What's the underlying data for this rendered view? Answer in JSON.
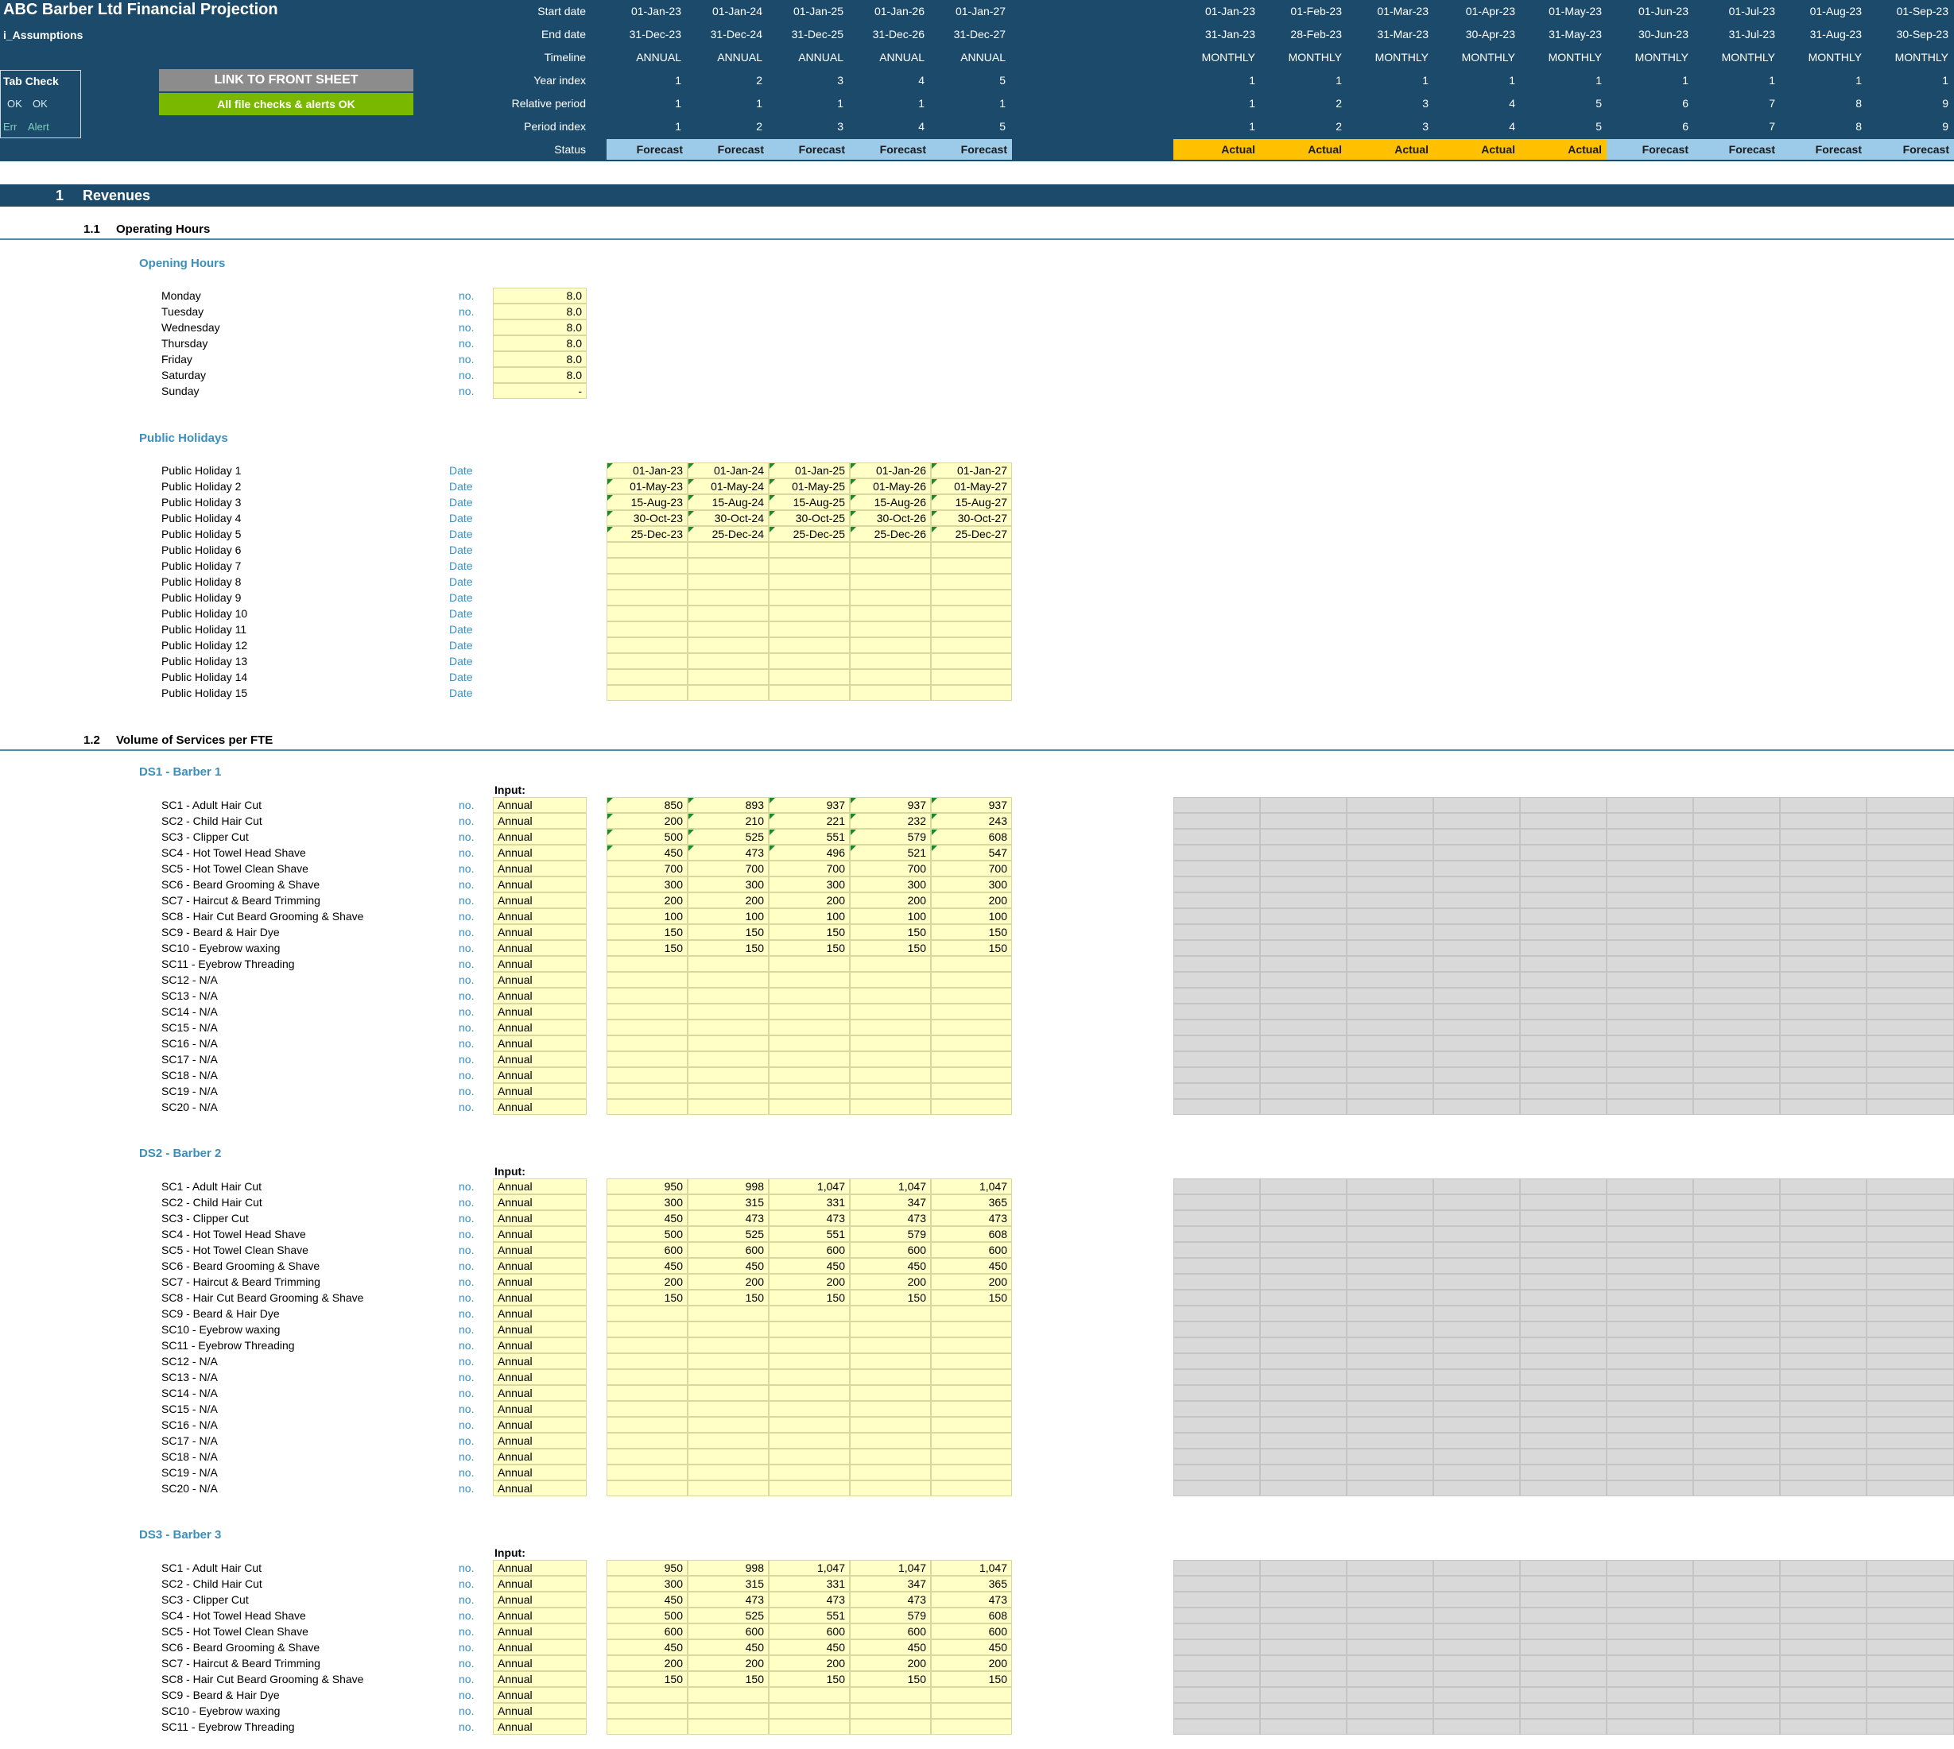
{
  "header": {
    "title": "ABC Barber Ltd Financial Projection",
    "sheet": "i_Assumptions",
    "row_labels": [
      "Start date",
      "End date",
      "Timeline",
      "Year index",
      "Relative period",
      "Period index",
      "Status"
    ],
    "annual": [
      {
        "start": "01-Jan-23",
        "end": "31-Dec-23",
        "timeline": "ANNUAL",
        "year": "1",
        "rel": "1",
        "period": "1",
        "status": "Forecast"
      },
      {
        "start": "01-Jan-24",
        "end": "31-Dec-24",
        "timeline": "ANNUAL",
        "year": "2",
        "rel": "1",
        "period": "2",
        "status": "Forecast"
      },
      {
        "start": "01-Jan-25",
        "end": "31-Dec-25",
        "timeline": "ANNUAL",
        "year": "3",
        "rel": "1",
        "period": "3",
        "status": "Forecast"
      },
      {
        "start": "01-Jan-26",
        "end": "31-Dec-26",
        "timeline": "ANNUAL",
        "year": "4",
        "rel": "1",
        "period": "4",
        "status": "Forecast"
      },
      {
        "start": "01-Jan-27",
        "end": "31-Dec-27",
        "timeline": "ANNUAL",
        "year": "5",
        "rel": "1",
        "period": "5",
        "status": "Forecast"
      }
    ],
    "monthly": [
      {
        "start": "01-Jan-23",
        "end": "31-Jan-23",
        "timeline": "MONTHLY",
        "year": "1",
        "rel": "1",
        "period": "1",
        "status": "Actual"
      },
      {
        "start": "01-Feb-23",
        "end": "28-Feb-23",
        "timeline": "MONTHLY",
        "year": "1",
        "rel": "2",
        "period": "2",
        "status": "Actual"
      },
      {
        "start": "01-Mar-23",
        "end": "31-Mar-23",
        "timeline": "MONTHLY",
        "year": "1",
        "rel": "3",
        "period": "3",
        "status": "Actual"
      },
      {
        "start": "01-Apr-23",
        "end": "30-Apr-23",
        "timeline": "MONTHLY",
        "year": "1",
        "rel": "4",
        "period": "4",
        "status": "Actual"
      },
      {
        "start": "01-May-23",
        "end": "31-May-23",
        "timeline": "MONTHLY",
        "year": "1",
        "rel": "5",
        "period": "5",
        "status": "Actual"
      },
      {
        "start": "01-Jun-23",
        "end": "30-Jun-23",
        "timeline": "MONTHLY",
        "year": "1",
        "rel": "6",
        "period": "6",
        "status": "Forecast"
      },
      {
        "start": "01-Jul-23",
        "end": "31-Jul-23",
        "timeline": "MONTHLY",
        "year": "1",
        "rel": "7",
        "period": "7",
        "status": "Forecast"
      },
      {
        "start": "01-Aug-23",
        "end": "31-Aug-23",
        "timeline": "MONTHLY",
        "year": "1",
        "rel": "8",
        "period": "8",
        "status": "Forecast"
      },
      {
        "start": "01-Sep-23",
        "end": "30-Sep-23",
        "timeline": "MONTHLY",
        "year": "1",
        "rel": "9",
        "period": "9",
        "status": "Forecast"
      }
    ],
    "tab_check": {
      "title": "Tab Check",
      "ok1": "OK",
      "ok2": "OK",
      "err": "Err",
      "alert": "Alert"
    },
    "link_button": "LINK TO FRONT SHEET",
    "checks_status": "All file checks & alerts OK"
  },
  "section": {
    "number": "1",
    "title": "Revenues"
  },
  "opening": {
    "sub_number": "1.1",
    "sub_title": "Operating Hours",
    "group_title": "Opening Hours",
    "unit": "no.",
    "days": [
      {
        "name": "Monday",
        "value": "8.0"
      },
      {
        "name": "Tuesday",
        "value": "8.0"
      },
      {
        "name": "Wednesday",
        "value": "8.0"
      },
      {
        "name": "Thursday",
        "value": "8.0"
      },
      {
        "name": "Friday",
        "value": "8.0"
      },
      {
        "name": "Saturday",
        "value": "8.0"
      },
      {
        "name": "Sunday",
        "value": "-"
      }
    ]
  },
  "holidays": {
    "group_title": "Public Holidays",
    "unit": "Date",
    "rows": [
      {
        "name": "Public Holiday 1",
        "values": [
          "01-Jan-23",
          "01-Jan-24",
          "01-Jan-25",
          "01-Jan-26",
          "01-Jan-27"
        ]
      },
      {
        "name": "Public Holiday 2",
        "values": [
          "01-May-23",
          "01-May-24",
          "01-May-25",
          "01-May-26",
          "01-May-27"
        ]
      },
      {
        "name": "Public Holiday 3",
        "values": [
          "15-Aug-23",
          "15-Aug-24",
          "15-Aug-25",
          "15-Aug-26",
          "15-Aug-27"
        ]
      },
      {
        "name": "Public Holiday 4",
        "values": [
          "30-Oct-23",
          "30-Oct-24",
          "30-Oct-25",
          "30-Oct-26",
          "30-Oct-27"
        ]
      },
      {
        "name": "Public Holiday 5",
        "values": [
          "25-Dec-23",
          "25-Dec-24",
          "25-Dec-25",
          "25-Dec-26",
          "25-Dec-27"
        ]
      },
      {
        "name": "Public Holiday 6",
        "values": [
          "",
          "",
          "",
          "",
          ""
        ]
      },
      {
        "name": "Public Holiday 7",
        "values": [
          "",
          "",
          "",
          "",
          ""
        ]
      },
      {
        "name": "Public Holiday 8",
        "values": [
          "",
          "",
          "",
          "",
          ""
        ]
      },
      {
        "name": "Public Holiday 9",
        "values": [
          "",
          "",
          "",
          "",
          ""
        ]
      },
      {
        "name": "Public Holiday 10",
        "values": [
          "",
          "",
          "",
          "",
          ""
        ]
      },
      {
        "name": "Public Holiday 11",
        "values": [
          "",
          "",
          "",
          "",
          ""
        ]
      },
      {
        "name": "Public Holiday 12",
        "values": [
          "",
          "",
          "",
          "",
          ""
        ]
      },
      {
        "name": "Public Holiday 13",
        "values": [
          "",
          "",
          "",
          "",
          ""
        ]
      },
      {
        "name": "Public Holiday 14",
        "values": [
          "",
          "",
          "",
          "",
          ""
        ]
      },
      {
        "name": "Public Holiday 15",
        "values": [
          "",
          "",
          "",
          "",
          ""
        ]
      }
    ]
  },
  "volume": {
    "sub_number": "1.2",
    "sub_title": "Volume of Services per FTE",
    "input_label": "Input:",
    "unit": "no.",
    "freq": "Annual",
    "services": [
      "SC1 - Adult Hair Cut",
      "SC2 - Child Hair Cut",
      "SC3 - Clipper Cut",
      "SC4 - Hot Towel Head Shave",
      "SC5 - Hot Towel Clean Shave",
      "SC6 - Beard Grooming & Shave",
      "SC7 - Haircut & Beard Trimming",
      "SC8 - Hair Cut Beard Grooming & Shave",
      "SC9 - Beard & Hair Dye",
      "SC10 - Eyebrow waxing",
      "SC11 - Eyebrow Threading",
      "SC12 - N/A",
      "SC13 - N/A",
      "SC14 - N/A",
      "SC15 - N/A",
      "SC16 - N/A",
      "SC17 - N/A",
      "SC18 - N/A",
      "SC19 - N/A",
      "SC20 - N/A"
    ],
    "barbers": [
      {
        "title": "DS1 - Barber 1",
        "rows": 20,
        "values": [
          [
            "850",
            "893",
            "937",
            "937",
            "937"
          ],
          [
            "200",
            "210",
            "221",
            "232",
            "243"
          ],
          [
            "500",
            "525",
            "551",
            "579",
            "608"
          ],
          [
            "450",
            "473",
            "496",
            "521",
            "547"
          ],
          [
            "700",
            "700",
            "700",
            "700",
            "700"
          ],
          [
            "300",
            "300",
            "300",
            "300",
            "300"
          ],
          [
            "200",
            "200",
            "200",
            "200",
            "200"
          ],
          [
            "100",
            "100",
            "100",
            "100",
            "100"
          ],
          [
            "150",
            "150",
            "150",
            "150",
            "150"
          ],
          [
            "150",
            "150",
            "150",
            "150",
            "150"
          ]
        ],
        "flagged_rows": 4
      },
      {
        "title": "DS2 - Barber 2",
        "rows": 20,
        "values": [
          [
            "950",
            "998",
            "1,047",
            "1,047",
            "1,047"
          ],
          [
            "300",
            "315",
            "331",
            "347",
            "365"
          ],
          [
            "450",
            "473",
            "473",
            "473",
            "473"
          ],
          [
            "500",
            "525",
            "551",
            "579",
            "608"
          ],
          [
            "600",
            "600",
            "600",
            "600",
            "600"
          ],
          [
            "450",
            "450",
            "450",
            "450",
            "450"
          ],
          [
            "200",
            "200",
            "200",
            "200",
            "200"
          ],
          [
            "150",
            "150",
            "150",
            "150",
            "150"
          ]
        ],
        "flagged_rows": 0
      },
      {
        "title": "DS3 - Barber 3",
        "rows": 12,
        "values": [
          [
            "950",
            "998",
            "1,047",
            "1,047",
            "1,047"
          ],
          [
            "300",
            "315",
            "331",
            "347",
            "365"
          ],
          [
            "450",
            "473",
            "473",
            "473",
            "473"
          ],
          [
            "500",
            "525",
            "551",
            "579",
            "608"
          ],
          [
            "600",
            "600",
            "600",
            "600",
            "600"
          ],
          [
            "450",
            "450",
            "450",
            "450",
            "450"
          ],
          [
            "200",
            "200",
            "200",
            "200",
            "200"
          ],
          [
            "150",
            "150",
            "150",
            "150",
            "150"
          ]
        ],
        "flagged_rows": 0
      }
    ]
  },
  "colors": {
    "header": "#1b4a6a",
    "input": "#ffffc6",
    "actual": "#ffc000",
    "forecast": "#9ccbe9",
    "ok_green": "#7ab800",
    "group_blue": "#3a8fbf"
  }
}
